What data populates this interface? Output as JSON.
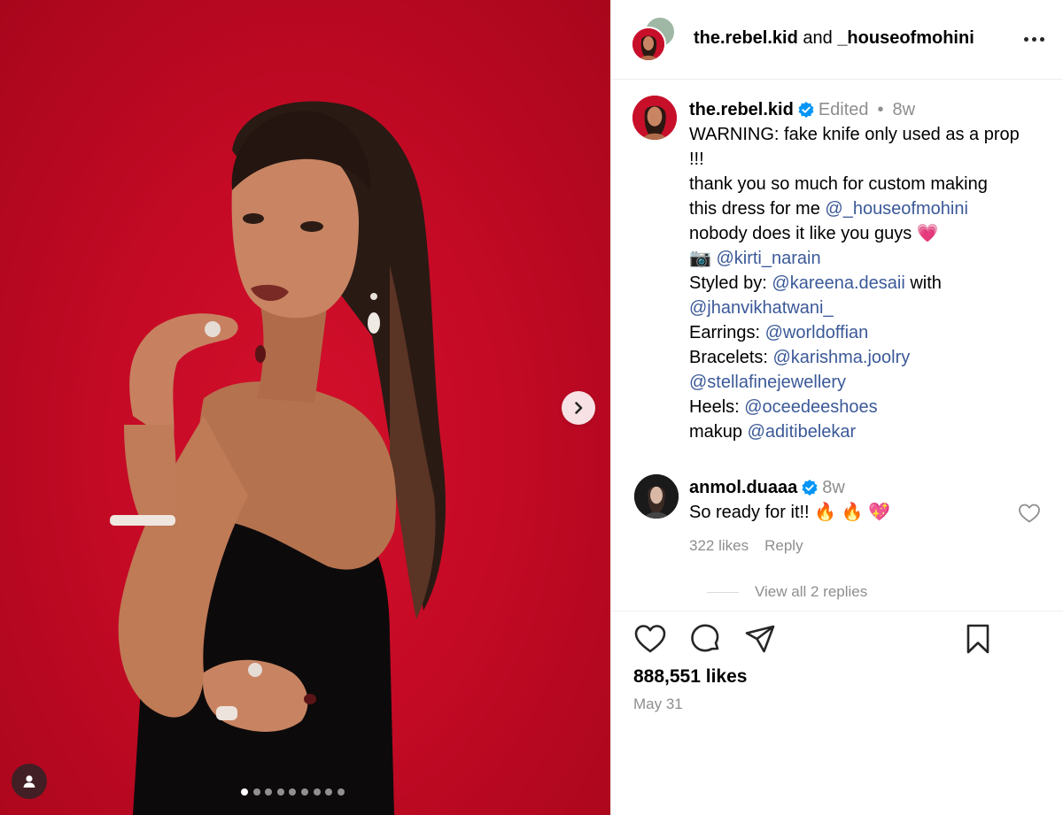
{
  "header": {
    "author": "the.rebel.kid",
    "conjunction": "and",
    "collaborator": "_houseofmohini"
  },
  "caption": {
    "username": "the.rebel.kid",
    "edited": "Edited",
    "separator": "•",
    "age": "8w",
    "lines": {
      "l1": "WARNING: fake knife only used as a prop",
      "l2": "!!!",
      "l3": "thank you so much for custom making",
      "l4_text": "this dress for me ",
      "l4_mention": "@_houseofmohini",
      "l5_text": "nobody does it like you guys ",
      "l5_emoji": "💗",
      "l6_emoji": "📷",
      "l6_mention": "@kirti_narain",
      "l7_text": "Styled by: ",
      "l7_mention": "@kareena.desaii",
      "l7_tail": " with",
      "l8_mention": "@jhanvikhatwani_",
      "l9_text": "Earrings: ",
      "l9_mention": "@worldoffian",
      "l10_text": "Bracelets: ",
      "l10_mention": "@karishma.joolry",
      "l11_mention": "@stellafinejewellery",
      "l12_text": "Heels: ",
      "l12_mention": "@oceedeeshoes",
      "l13_text": "makup ",
      "l13_mention": "@aditibelekar"
    }
  },
  "comment": {
    "username": "anmol.duaaa",
    "age": "8w",
    "text": "So ready for it!! ",
    "emojis": "🔥 🔥 💖",
    "likes": "322 likes",
    "reply": "Reply",
    "view_replies": "View all 2 replies"
  },
  "post": {
    "likes": "888,551 likes",
    "date": "May 31"
  },
  "media": {
    "carousel_total": 9,
    "carousel_active": 1
  },
  "icons": {
    "like": "heart-icon",
    "comment": "comment-bubble-icon",
    "share": "paper-plane-icon",
    "save": "bookmark-icon",
    "more": "more-horizontal-icon",
    "next": "chevron-right-icon",
    "tag": "user-tag-icon",
    "verified": "verified-badge-icon"
  },
  "colors": {
    "backdrop_red": "#c40a25",
    "mention_link": "#3b5998",
    "verified_blue": "#0095f6",
    "muted_text": "#8e8e8e"
  }
}
